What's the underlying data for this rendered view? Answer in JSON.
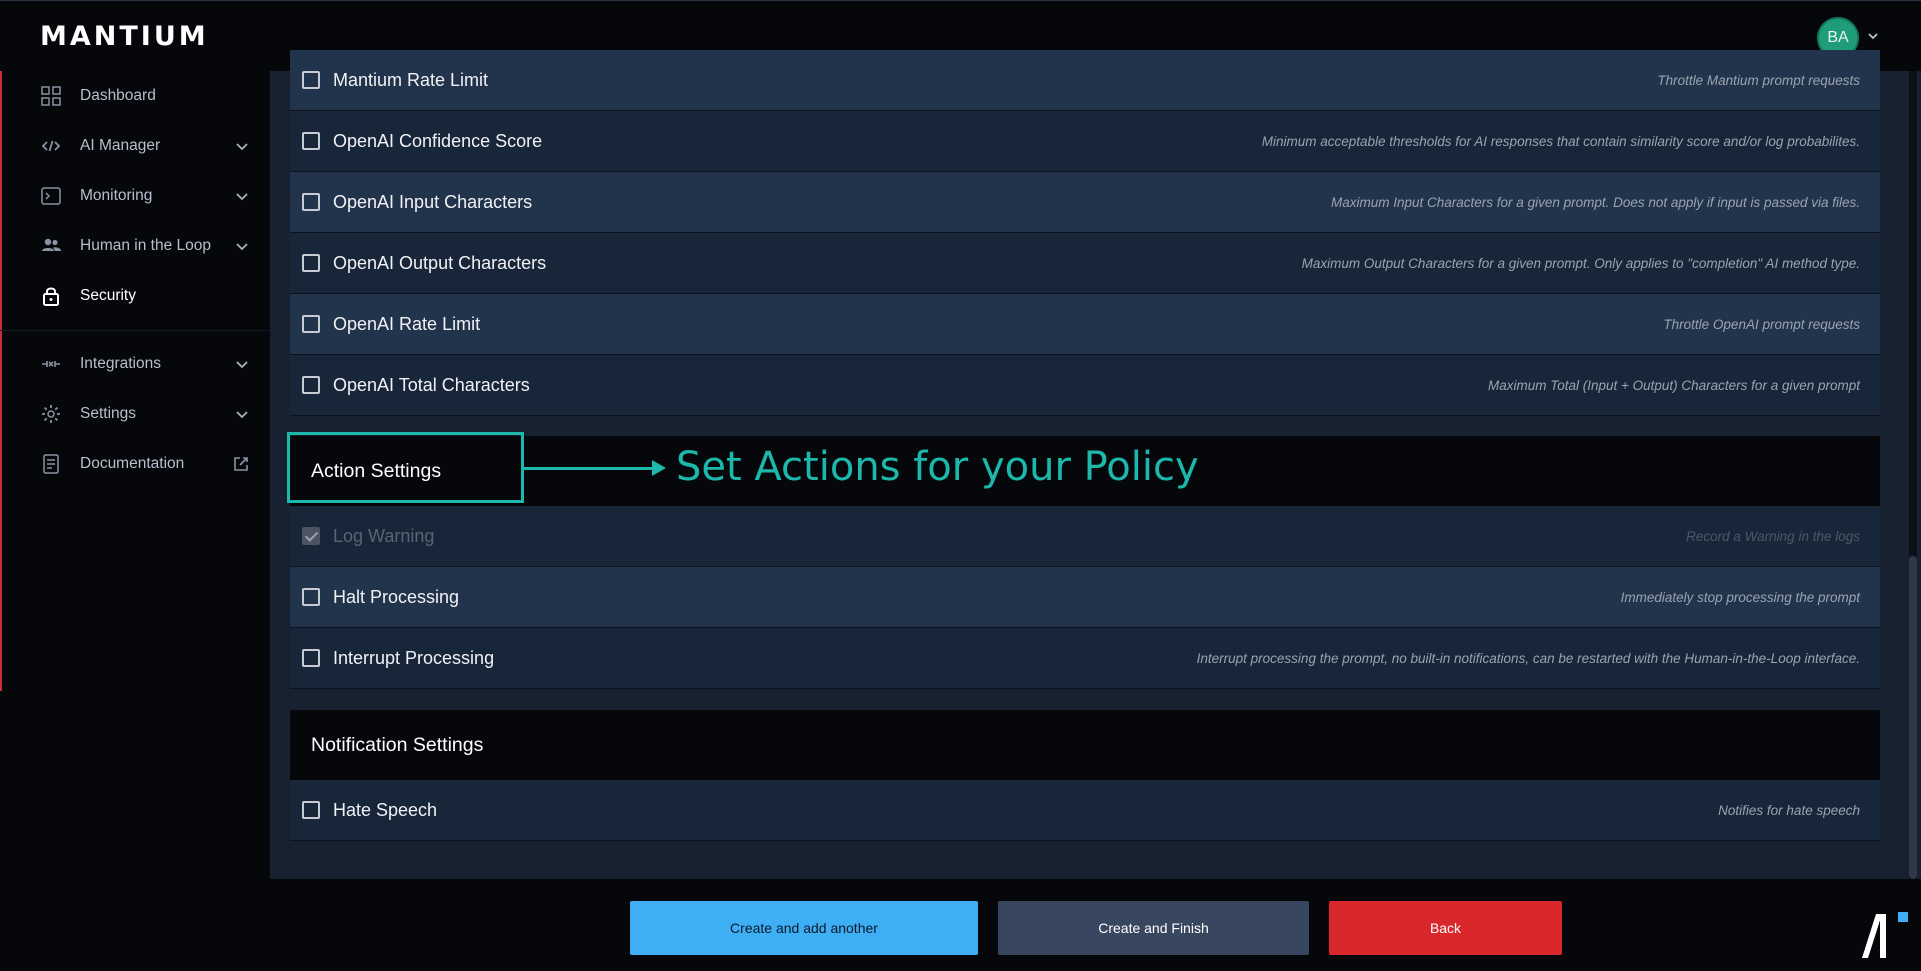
{
  "header": {
    "logo": "MANTIUM",
    "avatar_initials": "BA",
    "avatar_color": "#1f9c7a"
  },
  "sidebar": {
    "items": [
      {
        "label": "Dashboard",
        "icon": "grid-icon"
      },
      {
        "label": "AI Manager",
        "icon": "code-icon"
      },
      {
        "label": "Monitoring",
        "icon": "terminal-icon"
      },
      {
        "label": "Human in the Loop",
        "icon": "people-icon"
      },
      {
        "label": "Security",
        "icon": "lock-icon",
        "active": true
      },
      {
        "label": "Integrations",
        "icon": "plug-icon"
      },
      {
        "label": "Settings",
        "icon": "gear-icon"
      },
      {
        "label": "Documentation",
        "icon": "document-icon"
      }
    ]
  },
  "policy_rows": [
    {
      "label": "Mantium Rate Limit",
      "desc": "Throttle Mantium prompt requests"
    },
    {
      "label": "OpenAI Confidence Score",
      "desc": "Minimum acceptable thresholds for AI responses that contain similarity score and/or log probabilites."
    },
    {
      "label": "OpenAI Input Characters",
      "desc": "Maximum Input Characters for a given prompt. Does not apply if input is passed via files."
    },
    {
      "label": "OpenAI Output Characters",
      "desc": "Maximum Output Characters for a given prompt. Only applies to \"completion\" AI method type."
    },
    {
      "label": "OpenAI Rate Limit",
      "desc": "Throttle OpenAI prompt requests"
    },
    {
      "label": "OpenAI Total Characters",
      "desc": "Maximum Total (Input + Output) Characters for a given prompt"
    }
  ],
  "action_settings": {
    "title": "Action Settings",
    "annotation": "Set Actions for your Policy",
    "rows": [
      {
        "label": "Log Warning",
        "desc": "Record a Warning in the logs",
        "checked": true,
        "disabled": true
      },
      {
        "label": "Halt Processing",
        "desc": "Immediately stop processing the prompt"
      },
      {
        "label": "Interrupt Processing",
        "desc": "Interrupt processing the prompt, no built-in notifications, can be restarted with the Human-in-the-Loop interface."
      }
    ]
  },
  "notification_settings": {
    "title": "Notification Settings",
    "rows": [
      {
        "label": "Hate Speech",
        "desc": "Notifies for hate speech"
      }
    ]
  },
  "footer": {
    "create_another": "Create and add another",
    "create_finish": "Create and Finish",
    "back": "Back"
  },
  "colors": {
    "accent_teal": "#1cb8ab",
    "primary_button": "#3eaef5",
    "secondary_button": "#38475f",
    "danger_button": "#d9272b"
  }
}
